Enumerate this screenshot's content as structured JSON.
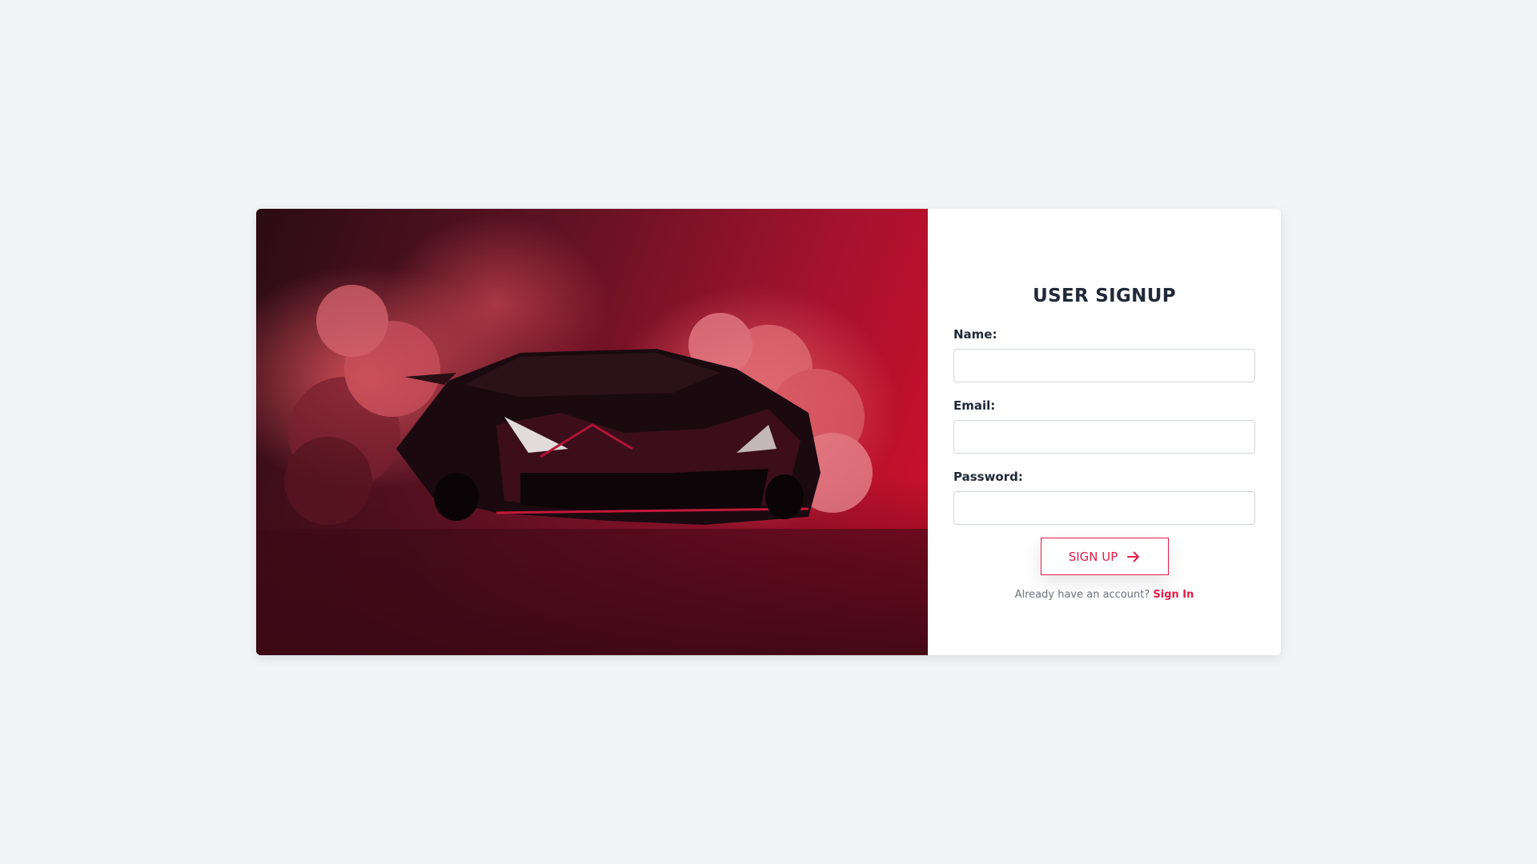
{
  "signup": {
    "title": "USER SIGNUP",
    "fields": [
      {
        "label": "Name:",
        "value": "",
        "placeholder": ""
      },
      {
        "label": "Email:",
        "value": "",
        "placeholder": ""
      },
      {
        "label": "Password:",
        "value": "",
        "placeholder": ""
      }
    ],
    "submit_label": "SIGN UP",
    "submit_icon": "arrow-right-icon",
    "signin_prompt": "Already have an account?",
    "signin_link": "Sign In"
  },
  "hero": {
    "image_subject": "red sports car in smoke",
    "colors": {
      "accent": "#e11d48",
      "hero_dark": "#2b0c14",
      "hero_bright": "#d30f2b"
    }
  }
}
